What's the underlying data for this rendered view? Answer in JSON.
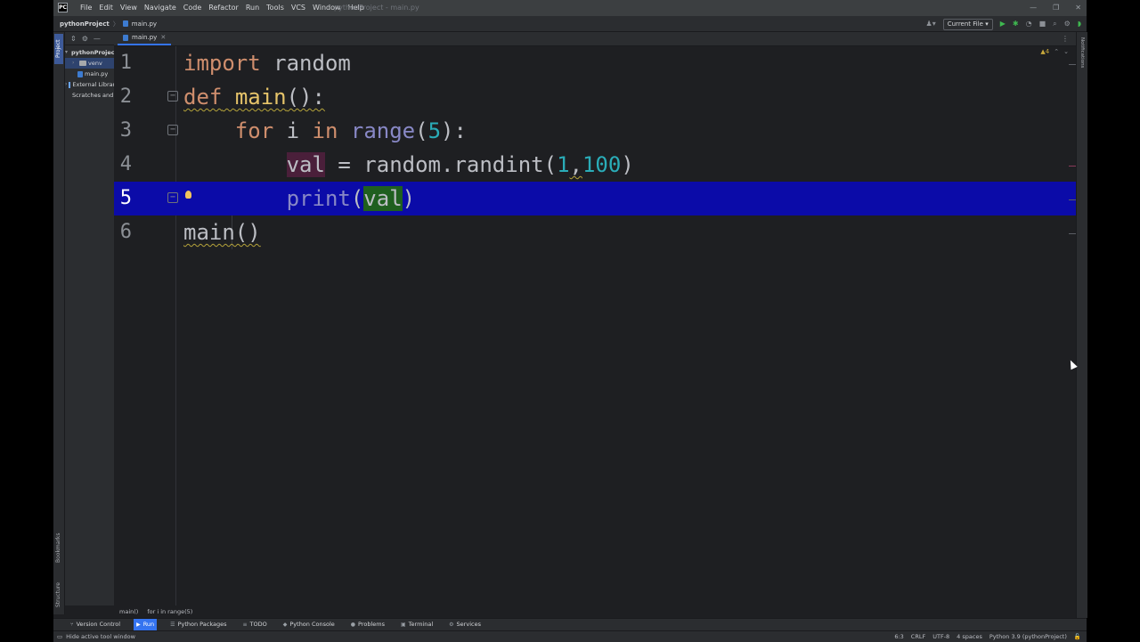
{
  "window": {
    "title": "pythonProject - main.py",
    "menu": [
      "File",
      "Edit",
      "View",
      "Navigate",
      "Code",
      "Refactor",
      "Run",
      "Tools",
      "VCS",
      "Window",
      "Help"
    ],
    "controls": [
      "—",
      "❐",
      "✕"
    ]
  },
  "navbar": {
    "project": "pythonProject",
    "file": "main.py",
    "run_config": "Current File"
  },
  "left_stripe": {
    "project_tab": "Project",
    "bookmarks": "Bookmarks",
    "structure": "Structure"
  },
  "project_tree": [
    {
      "label": "pythonProject",
      "kind": "folder",
      "indent": 0
    },
    {
      "label": "venv",
      "kind": "folder",
      "indent": 1
    },
    {
      "label": "main.py",
      "kind": "pyfile",
      "indent": 1
    },
    {
      "label": "External Libraries",
      "kind": "lib",
      "indent": 0
    },
    {
      "label": "Scratches and Consoles",
      "kind": "scratch",
      "indent": 0
    }
  ],
  "editor": {
    "tab_label": "main.py",
    "inspection_count": "▲4",
    "current_line": 5,
    "lines": [
      {
        "n": "1"
      },
      {
        "n": "2"
      },
      {
        "n": "3"
      },
      {
        "n": "4"
      },
      {
        "n": "5"
      },
      {
        "n": "6"
      }
    ],
    "tokens": {
      "l1_kw": "import",
      "l1_mod": " random",
      "l2_kw": "def",
      "l2_fn": "main",
      "l2_rest": "():",
      "l3_kw": "for",
      "l3_var": " i ",
      "l3_in": "in",
      "l3_range": " range",
      "l3_p1": "(",
      "l3_num": "5",
      "l3_p2": "):",
      "l4_var": "val",
      "l4_eq": " = random.",
      "l4_fn": "randint",
      "l4_p1": "(",
      "l4_n1": "1",
      "l4_comma": ",",
      "l4_n2": "100",
      "l4_p2": ")",
      "l5_fn": "print",
      "l5_p1": "(",
      "l5_arg": "val",
      "l5_p2": ")",
      "l6_call": "main()"
    }
  },
  "breadcrumb": [
    "main()",
    "for i in range(5)"
  ],
  "tool_windows": [
    {
      "label": "Version Control",
      "icon": "⑂",
      "active": false
    },
    {
      "label": "Run",
      "icon": "▶",
      "active": true
    },
    {
      "label": "Python Packages",
      "icon": "☰",
      "active": false
    },
    {
      "label": "TODO",
      "icon": "≡",
      "active": false
    },
    {
      "label": "Python Console",
      "icon": "◆",
      "active": false
    },
    {
      "label": "Problems",
      "icon": "●",
      "active": false
    },
    {
      "label": "Terminal",
      "icon": "▣",
      "active": false
    },
    {
      "label": "Services",
      "icon": "⚙",
      "active": false
    }
  ],
  "status": {
    "message": "Hide active tool window",
    "position": "6:3",
    "line_sep": "CRLF",
    "encoding": "UTF-8",
    "indent": "4 spaces",
    "interpreter": "Python 3.9 (pythonProject)"
  },
  "right_stripe": {
    "notifications": "Notifications"
  },
  "colors": {
    "current_line": "#0b0ba8",
    "accent": "#3574f0",
    "keyword": "#cf8e6d",
    "function": "#56a8f5",
    "number": "#2aacb8"
  }
}
